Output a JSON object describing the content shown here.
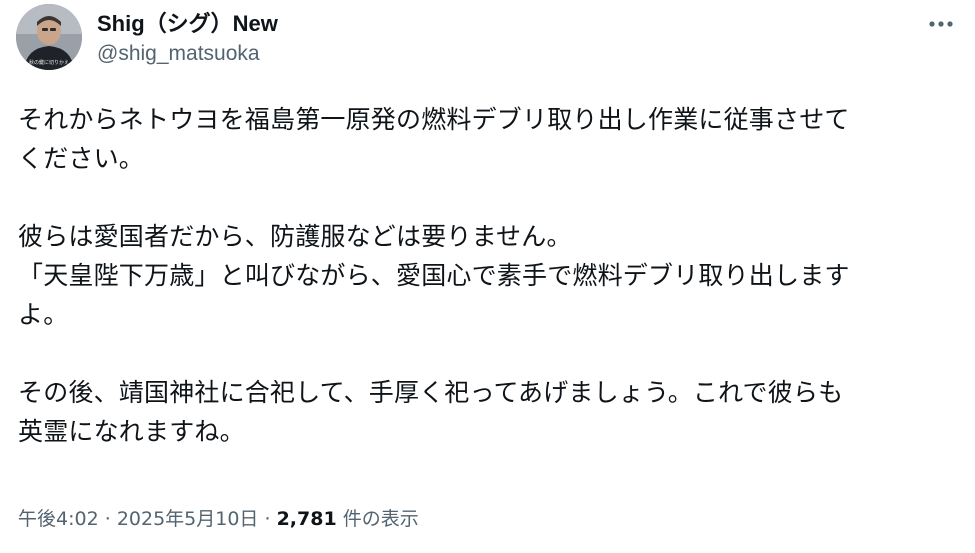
{
  "author": {
    "display_name": "Shig（シグ）New",
    "handle": "@shig_matsuoka"
  },
  "avatar": {
    "caption": "秋の鍵に切りかえ"
  },
  "tweet": {
    "paragraphs": [
      [
        "それからネトウヨを福島第一原発の燃料デブリ取り出し作業に従事させて",
        "ください。"
      ],
      [
        "彼らは愛国者だから、防護服などは要りません。",
        "「天皇陛下万歳」と叫びながら、愛国心で素手で燃料デブリ取り出します",
        "よ。"
      ],
      [
        "その後、靖国神社に合祀して、手厚く祀ってあげましょう。これで彼らも",
        "英霊になれますね。"
      ]
    ]
  },
  "meta": {
    "time": "午後4:02",
    "separator": "·",
    "date": "2025年5月10日",
    "views_count": "2,781",
    "views_label": "件の表示"
  },
  "icons": {
    "more": "more-horizontal-icon"
  },
  "colors": {
    "text_primary": "#0f1419",
    "text_secondary": "#536471",
    "background": "#ffffff"
  }
}
